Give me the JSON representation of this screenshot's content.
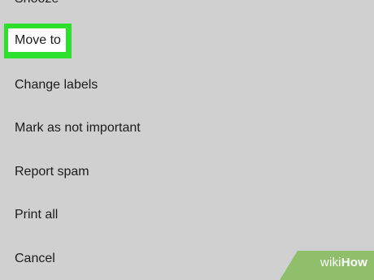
{
  "menu": {
    "items": [
      {
        "label": "Snooze"
      },
      {
        "label": "Move to"
      },
      {
        "label": "Change labels"
      },
      {
        "label": "Mark as not important"
      },
      {
        "label": "Report spam"
      },
      {
        "label": "Print all"
      },
      {
        "label": "Cancel"
      }
    ],
    "highlighted_item": "Move to"
  },
  "watermark": {
    "brand_prefix": "wiki",
    "brand_suffix": "How"
  },
  "colors": {
    "background": "#d0d0d0",
    "highlight": "#2ee02e",
    "text": "#1b1b1b",
    "watermark_bg": "#8fbf6a"
  }
}
